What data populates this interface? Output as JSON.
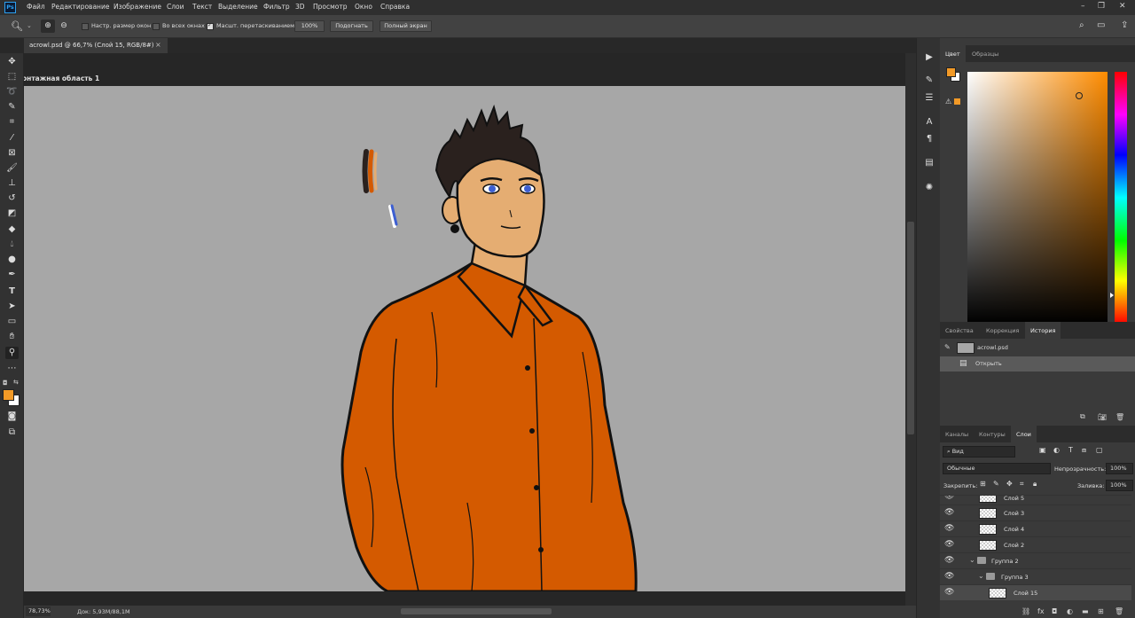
{
  "app": {
    "logo": "Ps"
  },
  "menu": [
    "Файл",
    "Редактирование",
    "Изображение",
    "Слои",
    "Текст",
    "Выделение",
    "Фильтр",
    "3D",
    "Просмотр",
    "Окно",
    "Справка"
  ],
  "options_bar": {
    "resize_windows": "Настр. размер окон",
    "all_windows": "Во всех окнах",
    "scrubby_zoom": "Масшт. перетаскиванием",
    "zoom_value": "100%",
    "fit_button": "Подогнать",
    "fullscreen_button": "Полный экран"
  },
  "document": {
    "tab_title": "acrowl.psd @ 66,7% (Слой 15, RGB/8#)",
    "artboard_label": "онтажная область 1"
  },
  "status": {
    "zoom": "78,73%",
    "doc_size": "Док: 5,93M/88,1M"
  },
  "colors": {
    "foreground": "#f29a27",
    "background": "#ffffff",
    "shirt": "#d45a00",
    "canvas": "#a7a7a7",
    "skin": "#e5ad72",
    "hair": "#2a211e"
  },
  "panels": {
    "color_tabs": [
      "Цвет",
      "Образцы"
    ],
    "history_tabs": [
      "Свойства",
      "Коррекция",
      "История"
    ],
    "layers_tabs": [
      "Каналы",
      "Контуры",
      "Слои"
    ]
  },
  "history": {
    "snapshot": "acrowl.psd",
    "items": [
      "Открыть"
    ]
  },
  "layers": {
    "filter_kind": "Вид",
    "blend_mode": "Обычные",
    "opacity_label": "Непрозрачность:",
    "opacity_value": "100%",
    "lock_label": "Закрепить:",
    "fill_label": "Заливка:",
    "fill_value": "100%",
    "items": [
      {
        "name": "Слой 5"
      },
      {
        "name": "Слой 3"
      },
      {
        "name": "Слой 4"
      },
      {
        "name": "Слой 2"
      },
      {
        "name": "Группа 2"
      },
      {
        "name": "Группа 3"
      },
      {
        "name": "Слой 15"
      }
    ]
  }
}
